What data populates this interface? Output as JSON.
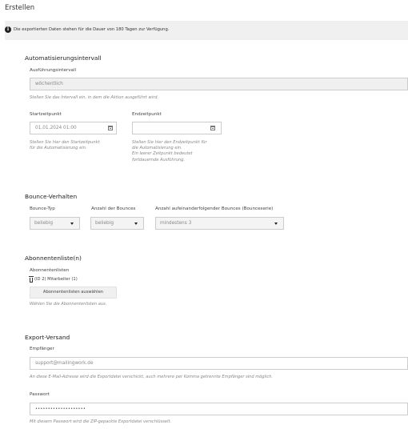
{
  "page": {
    "title": "Erstellen"
  },
  "info": {
    "text": "Die exportierten Daten stehen für die Dauer von 180 Tagen zur Verfügung."
  },
  "automation": {
    "title": "Automatisierungsintervall",
    "interval_label": "Ausführungsintervall",
    "interval_value": "wöchentlich",
    "interval_hint": "Stellen Sie das Intervall ein, in dem die Aktion ausgeführt wird.",
    "start_label": "Startzeitpunkt",
    "start_value": "01.01.2024 01:00",
    "start_hint_1": "Stellen Sie hier den Startzeitpunkt",
    "start_hint_2": "für die Automatisierung ein.",
    "end_label": "Endzeitpunkt",
    "end_value": "",
    "end_hint_1": "Stellen Sie hier den Endzeitpunkt für",
    "end_hint_2": "die Automatisierung ein.",
    "end_hint_3": "Ein leerer Zeitpunkt bedeutet",
    "end_hint_4": "fortdauernde Ausführung."
  },
  "bounce": {
    "title": "Bounce-Verhalten",
    "type_label": "Bounce-Typ",
    "type_value": "beliebig",
    "count_label": "Anzahl der Bounces",
    "count_value": "beliebig",
    "series_label": "Anzahl aufeinanderfolgender Bounces (Bounceserie)",
    "series_value": "mindestens 3"
  },
  "lists": {
    "title": "Abonnentenliste(n)",
    "label": "Abonnentenlisten",
    "entry": "(ID 2) Mitarbeiter (1)",
    "button": "Abonnentenlisten auswählen",
    "hint": "Wählen Sie die Abonnentenlisten aus."
  },
  "export": {
    "title": "Export-Versand",
    "recipient_label": "Empfänger",
    "recipient_value": "support@mailingwork.de",
    "recipient_hint": "An diese E-Mail-Adresse wird die Exportdatei verschickt, auch mehrere per Komma getrennte Empfänger sind möglich.",
    "password_label": "Passwort",
    "password_value": "••••••••••••••••••••",
    "password_hint": "Mit diesem Passwort wird die ZIP-gepackte Exportdatei verschlüsselt."
  },
  "icons": {
    "info": "info-circle-icon",
    "calendar": "calendar-icon",
    "caret": "caret-down-icon",
    "trash": "trash-icon"
  }
}
